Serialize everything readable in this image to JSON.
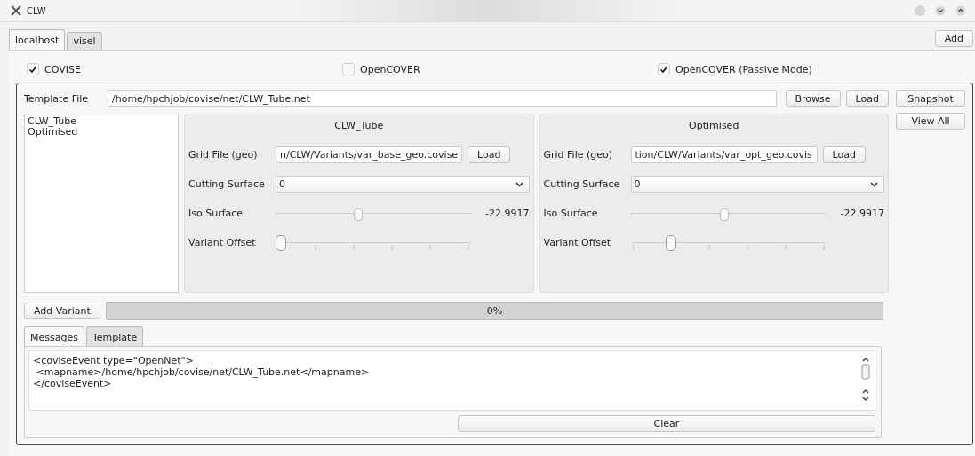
{
  "window": {
    "title": "CLW"
  },
  "host_tabs": [
    {
      "label": "localhost",
      "selected": true
    },
    {
      "label": "visel",
      "selected": false
    }
  ],
  "add_button": "Add",
  "options": [
    {
      "label": "COVISE",
      "checked": true
    },
    {
      "label": "OpenCOVER",
      "checked": false
    },
    {
      "label": "OpenCOVER (Passive Mode)",
      "checked": true
    }
  ],
  "template_file": {
    "label": "Template File",
    "value": "/home/hpchjob/covise/net/CLW_Tube.net",
    "buttons": [
      "Browse",
      "Load"
    ]
  },
  "side_buttons": [
    "Snapshot",
    "View All"
  ],
  "variants_list": [
    {
      "label": "CLW_Tube",
      "selected": false
    },
    {
      "label": "Optimised",
      "selected": false
    }
  ],
  "variants": [
    {
      "title": "CLW_Tube",
      "grid_label": "Grid File (geo)",
      "grid_value": "n/CLW/Variants/var_base_geo.covise",
      "load": "Load",
      "cutting_label": "Cutting Surface",
      "cutting_value": "0",
      "iso_label": "Iso Surface",
      "iso_slider": {
        "level": 0.42
      },
      "iso_reading": "-22.9917",
      "offset_label": "Variant Offset",
      "offset_slider": {
        "level": 0
      }
    },
    {
      "title": "Optimised",
      "grid_label": "Grid File (geo)",
      "grid_value": "tion/CLW/Variants/var_opt_geo.covis",
      "load": "Load",
      "cutting_label": "Cutting Surface",
      "cutting_value": "0",
      "iso_label": "Iso Surface",
      "iso_slider": {
        "level": 0.48
      },
      "iso_reading": "-22.9917",
      "offset_label": "Variant Offset",
      "offset_slider": {
        "level": 0.19
      }
    }
  ],
  "add_variant": "Add Variant",
  "progress": {
    "level": 0,
    "text": "0%"
  },
  "bottom_tabs": [
    {
      "label": "Messages",
      "selected": true
    },
    {
      "label": "Template",
      "selected": false
    }
  ],
  "messages": [
    "<coviseEvent type=\"OpenNet\">",
    " <mapname>/home/hpchjob/covise/net/CLW_Tube.net</mapname>",
    "</coviseEvent>"
  ],
  "clear_button": "Clear"
}
